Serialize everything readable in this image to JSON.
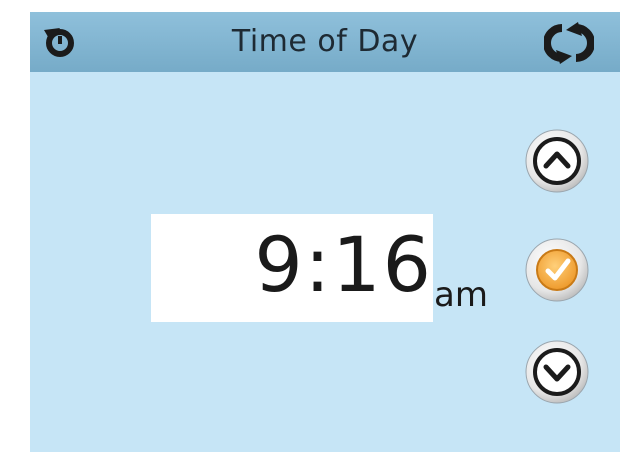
{
  "header": {
    "title": "Time of Day",
    "back_icon": "back-arrow-icon",
    "refresh_icon": "refresh-icon"
  },
  "clock": {
    "time": "9:16",
    "period": "am"
  },
  "controls": {
    "up_icon": "chevron-up-icon",
    "confirm_icon": "checkmark-icon",
    "down_icon": "chevron-down-icon"
  },
  "colors": {
    "background": "#c6e5f6",
    "header": "#84b7d3",
    "confirm_accent": "#f0a43a"
  }
}
